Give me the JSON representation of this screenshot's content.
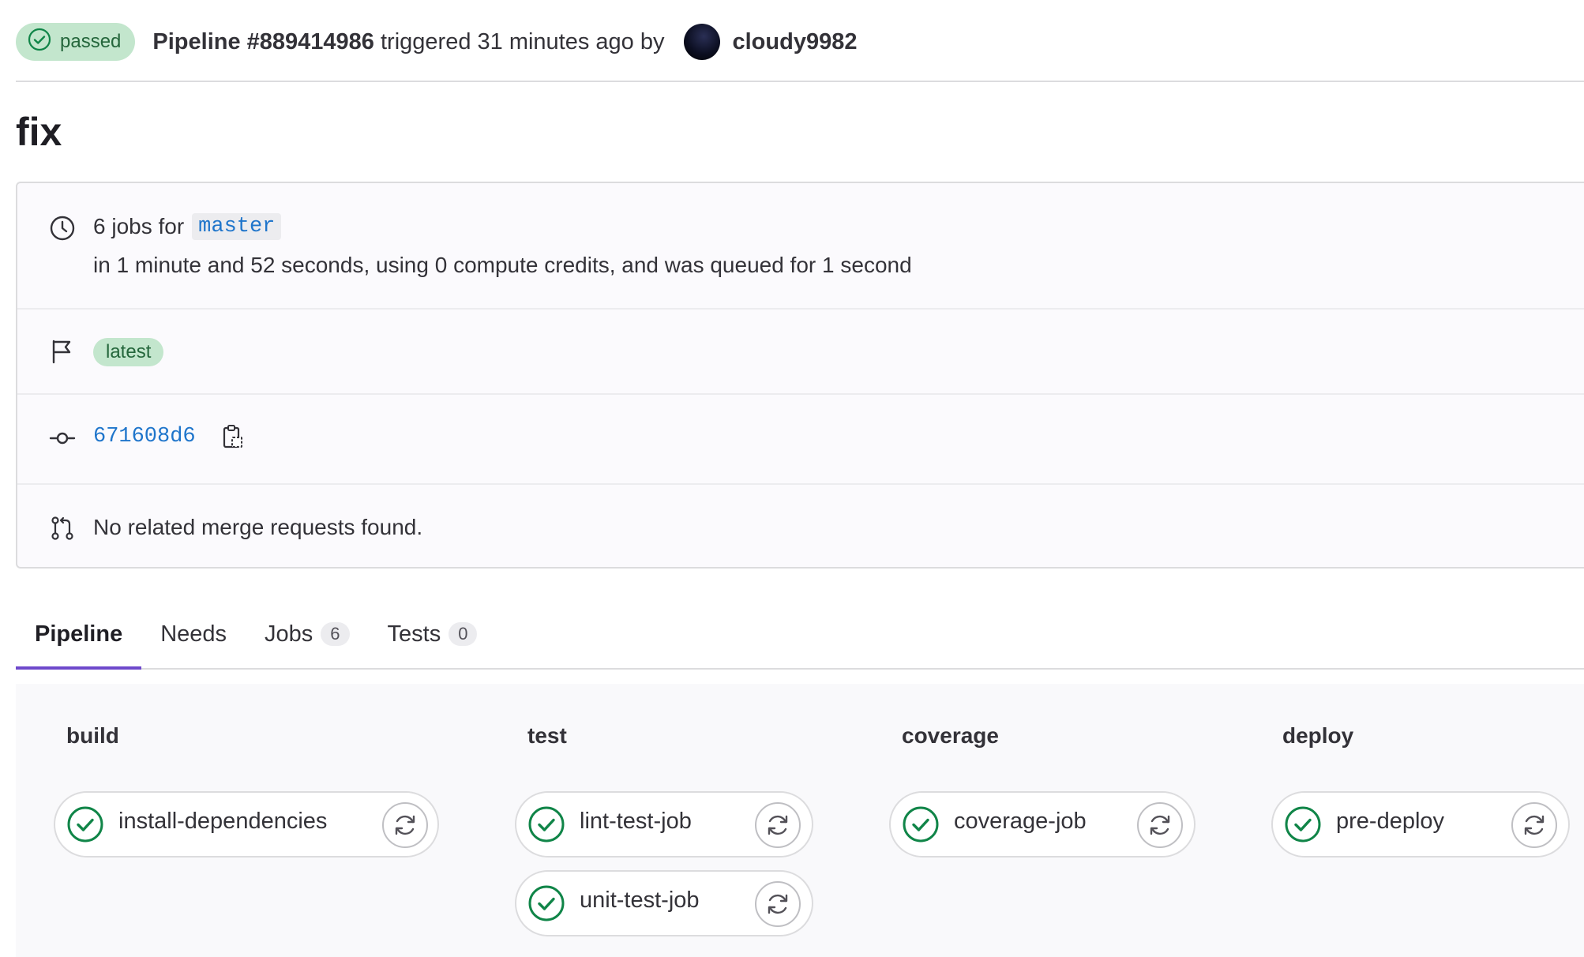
{
  "header": {
    "status": "passed",
    "pipeline_label": "Pipeline #889414986",
    "trigger_text": "triggered 31 minutes ago by",
    "author": "cloudy9982"
  },
  "title": "fix",
  "info": {
    "jobs_prefix": "6 jobs for",
    "branch": "master",
    "duration_text": "in 1 minute and 52 seconds, using 0 compute credits, and was queued for 1 second",
    "tag": "latest",
    "commit_sha": "671608d6",
    "merge_requests_text": "No related merge requests found."
  },
  "tabs": [
    {
      "label": "Pipeline",
      "active": true
    },
    {
      "label": "Needs"
    },
    {
      "label": "Jobs",
      "count": "6"
    },
    {
      "label": "Tests",
      "count": "0"
    }
  ],
  "stages": [
    {
      "name": "build",
      "jobs": [
        {
          "name": "install-dependencies",
          "status": "success"
        }
      ]
    },
    {
      "name": "test",
      "jobs": [
        {
          "name": "lint-test-job",
          "status": "success"
        },
        {
          "name": "unit-test-job",
          "status": "success"
        }
      ]
    },
    {
      "name": "coverage",
      "jobs": [
        {
          "name": "coverage-job",
          "status": "success"
        }
      ]
    },
    {
      "name": "deploy",
      "jobs": [
        {
          "name": "pre-deploy",
          "status": "success"
        }
      ]
    }
  ],
  "icons": {
    "status": "check-circle-icon",
    "duration": "clock-icon",
    "tags": "flag-icon",
    "commit": "commit-icon",
    "copy": "clipboard-icon",
    "merge_request": "merge-request-icon",
    "retry": "retry-icon"
  },
  "colors": {
    "success": "#108548",
    "success_bg": "#c3e6cd",
    "link": "#1f75cb",
    "tab_active": "#6e49cb"
  }
}
